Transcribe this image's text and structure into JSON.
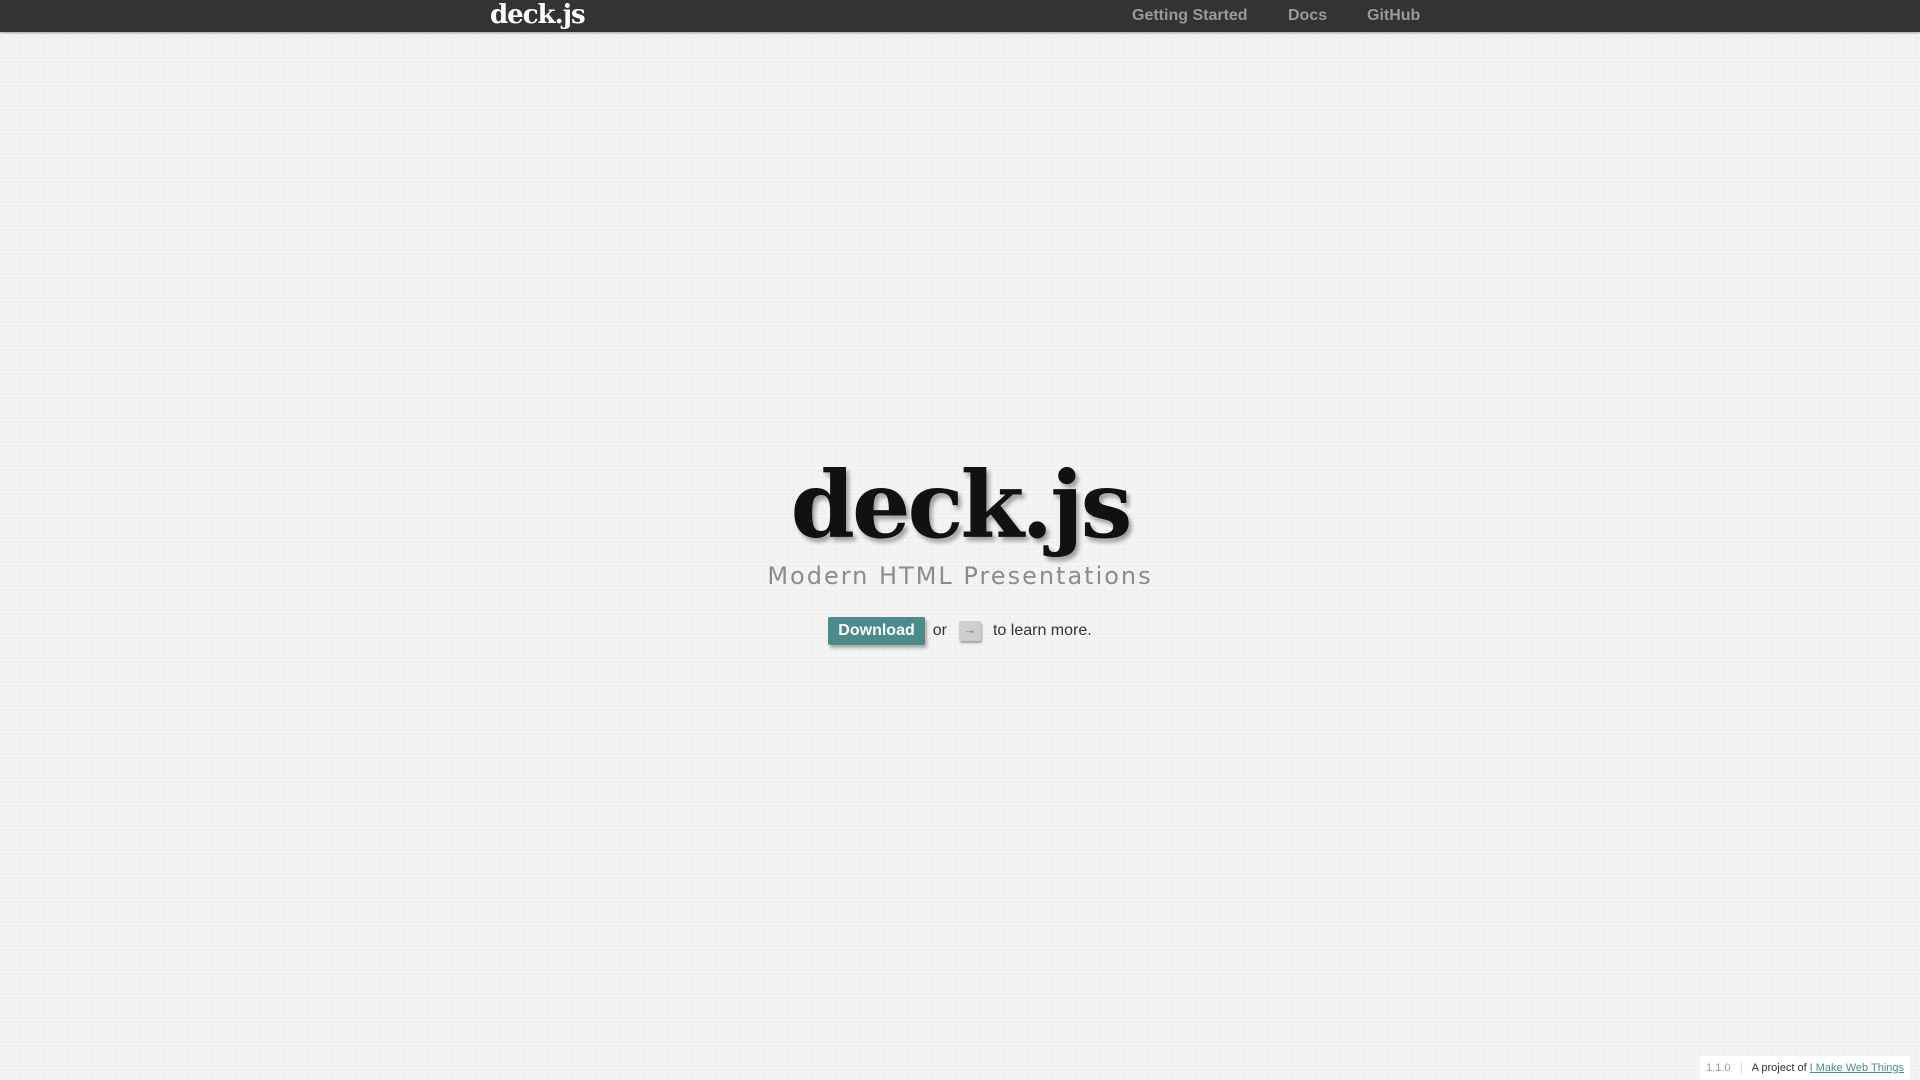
{
  "topbar": {
    "logo": "deck.js",
    "nav": {
      "getting_started": "Getting Started",
      "docs": "Docs",
      "github": "GitHub"
    }
  },
  "hero": {
    "logo": "deck.js",
    "tagline": "Modern HTML Presentations",
    "download_label": "Download",
    "or_text": "or",
    "key_glyph": "→",
    "learn_more": "to learn more."
  },
  "footer": {
    "version": "1.1.0",
    "project_text": "A project of",
    "link_text": "I Make Web Things"
  },
  "colors": {
    "topbar": "#333333",
    "accent": "#4b8b8b",
    "background": "#f3f3f3"
  }
}
